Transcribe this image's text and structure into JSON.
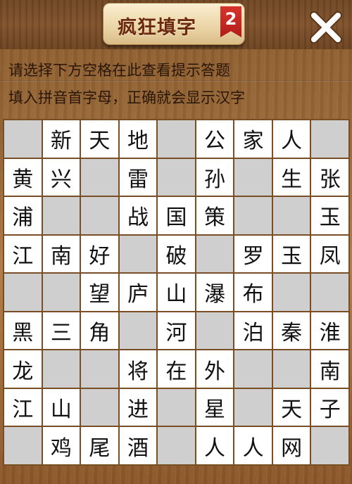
{
  "app": {
    "title": "疯狂填字",
    "title_badge": "2",
    "close_icon": "close-icon"
  },
  "hint": {
    "line1": "请选择下方空格在此查看提示答题",
    "line2": "填入拼音首字母，正确就会显示汉字"
  },
  "colors": {
    "header_wood": "#7d5029",
    "board_wood": "#9a6a38",
    "plaque": "#ecd6a9",
    "title_text": "#6b2a10",
    "badge_red": "#c22621",
    "filled_cell": "#ffffff",
    "blank_cell": "#cfcfcf",
    "grid_line": "#7a4e25",
    "char": "#111111"
  },
  "grid": {
    "rows": 9,
    "cols": 9,
    "cells": [
      [
        "",
        "新",
        "天",
        "地",
        "",
        "公",
        "家",
        "人",
        ""
      ],
      [
        "黄",
        "兴",
        "",
        "雷",
        "",
        "孙",
        "",
        "生",
        "张"
      ],
      [
        "浦",
        "",
        "",
        "战",
        "国",
        "策",
        "",
        "",
        "玉"
      ],
      [
        "江",
        "南",
        "好",
        "",
        "破",
        "",
        "罗",
        "玉",
        "凤"
      ],
      [
        "",
        "",
        "望",
        "庐",
        "山",
        "瀑",
        "布",
        "",
        ""
      ],
      [
        "黑",
        "三",
        "角",
        "",
        "河",
        "",
        "泊",
        "秦",
        "淮"
      ],
      [
        "龙",
        "",
        "",
        "将",
        "在",
        "外",
        "",
        "",
        "南"
      ],
      [
        "江",
        "山",
        "",
        "进",
        "",
        "星",
        "",
        "天",
        "子"
      ],
      [
        "",
        "鸡",
        "尾",
        "酒",
        "",
        "人",
        "人",
        "网",
        ""
      ]
    ]
  }
}
